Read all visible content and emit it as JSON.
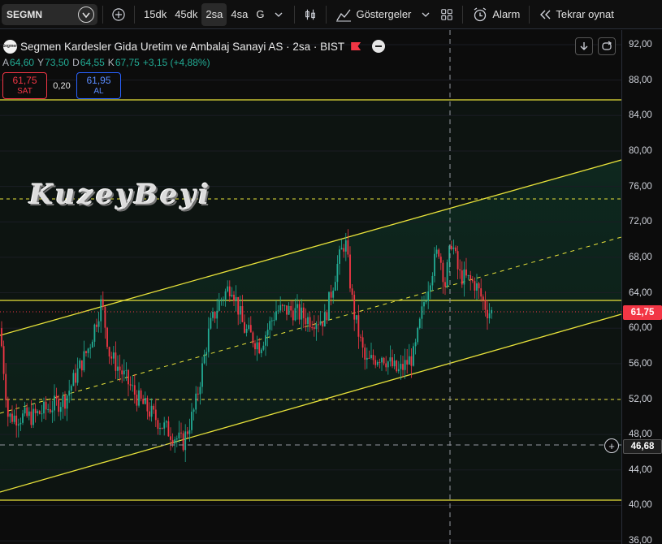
{
  "toolbar": {
    "symbol": "SEGMN",
    "intervals": [
      "15dk",
      "45dk",
      "2sa",
      "4sa",
      "G"
    ],
    "active_interval": "2sa",
    "indicators_label": "Göstergeler",
    "alarm_label": "Alarm",
    "replay_label": "Tekrar oynat"
  },
  "legend": {
    "title": "Segmen Kardesler Gida Uretim ve Ambalaj Sanayi AS · 2sa · BIST",
    "logo_text": "Segmen",
    "open_k": "A",
    "open_v": "64,60",
    "high_k": "Y",
    "high_v": "73,50",
    "low_k": "D",
    "low_v": "64,55",
    "close_k": "K",
    "close_v": "67,75",
    "change": "+3,15 (+4,88%)",
    "sell_price": "61,75",
    "sell_label": "SAT",
    "spread": "0,20",
    "buy_price": "61,95",
    "buy_label": "AL"
  },
  "watermark": "KuzeyBeyi",
  "price_scale": {
    "ticks": [
      "92,00",
      "88,00",
      "84,00",
      "80,00",
      "76,00",
      "72,00",
      "68,00",
      "64,00",
      "60,00",
      "56,00",
      "52,00",
      "48,00",
      "44,00",
      "40,00",
      "36,00"
    ],
    "current_price": "61,75",
    "crosshair_price": "46,68"
  },
  "colors": {
    "up": "#22ab94",
    "down": "#f23645",
    "drawing": "#e8e23a",
    "background": "#0c0c0c"
  },
  "icons": {
    "symbol_search": "magnifier-badge-icon",
    "compare": "plus-circle-icon",
    "chart_type": "candles-icon",
    "indicators": "indicators-icon",
    "layout": "grid-icon",
    "alarm": "alarm-clock-icon",
    "replay": "rewind-icon",
    "chevron": "chevron-down-icon",
    "download": "arrow-down-icon",
    "refresh": "refresh-icon",
    "add": "plus-icon"
  }
}
